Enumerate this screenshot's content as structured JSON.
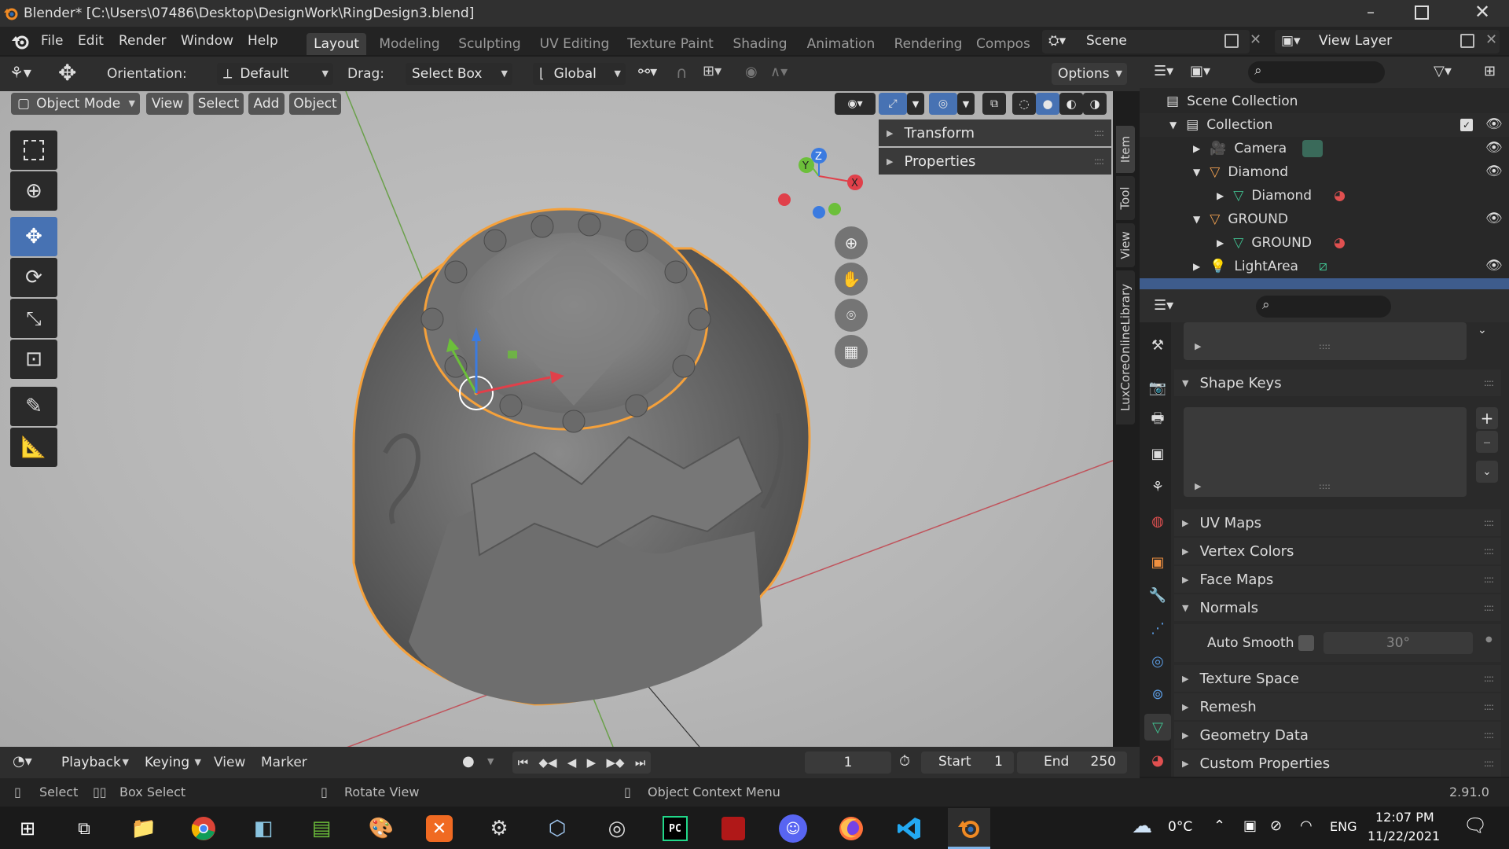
{
  "window": {
    "title": "Blender* [C:\\Users\\07486\\Desktop\\DesignWork\\RingDesign3.blend]"
  },
  "menu": [
    "File",
    "Edit",
    "Render",
    "Window",
    "Help"
  ],
  "workspaces": [
    "Layout",
    "Modeling",
    "Sculpting",
    "UV Editing",
    "Texture Paint",
    "Shading",
    "Animation",
    "Rendering",
    "Compos"
  ],
  "scene": {
    "name": "Scene",
    "view_layer": "View Layer"
  },
  "tool_header": {
    "orientation_label": "Orientation:",
    "orientation_value": "Default",
    "drag_label": "Drag:",
    "drag_value": "Select Box",
    "transform_orientation": "Global",
    "options": "Options"
  },
  "viewport_header": {
    "mode": "Object Mode",
    "menus": [
      "View",
      "Select",
      "Add",
      "Object"
    ]
  },
  "sidebar": {
    "panels": [
      "Transform",
      "Properties"
    ],
    "tabs": [
      "Item",
      "Tool",
      "View",
      "LuxCoreOnlineLibrary"
    ]
  },
  "gizmo": {
    "x": "X",
    "y": "Y",
    "z": "Z"
  },
  "outliner": {
    "root": "Scene Collection",
    "items": [
      {
        "label": "Collection"
      },
      {
        "label": "Camera"
      },
      {
        "label": "Diamond"
      },
      {
        "label": "Diamond"
      },
      {
        "label": "GROUND"
      },
      {
        "label": "GROUND"
      },
      {
        "label": "LightArea"
      }
    ]
  },
  "properties": {
    "sections": {
      "shape_keys": "Shape Keys",
      "uv_maps": "UV Maps",
      "vertex_colors": "Vertex Colors",
      "face_maps": "Face Maps",
      "normals": "Normals",
      "texture_space": "Texture Space",
      "remesh": "Remesh",
      "geometry_data": "Geometry Data",
      "custom_properties": "Custom Properties"
    },
    "auto_smooth_label": "Auto Smooth",
    "auto_smooth_angle": "30°"
  },
  "timeline": {
    "menus": [
      "Playback",
      "Keying",
      "View",
      "Marker"
    ],
    "current_frame": "1",
    "start_label": "Start",
    "start": "1",
    "end_label": "End",
    "end": "250"
  },
  "status_bar": {
    "select": "Select",
    "box_select": "Box Select",
    "rotate_view": "Rotate View",
    "context_menu": "Object Context Menu",
    "version": "2.91.0"
  },
  "taskbar": {
    "weather": "0°C",
    "lang": "ENG",
    "time": "12:07 PM",
    "date": "11/22/2021"
  },
  "colors": {
    "accent": "#4772b3",
    "selection_outline": "#f5a13b",
    "viewport_bg": "#b8b8b8"
  }
}
